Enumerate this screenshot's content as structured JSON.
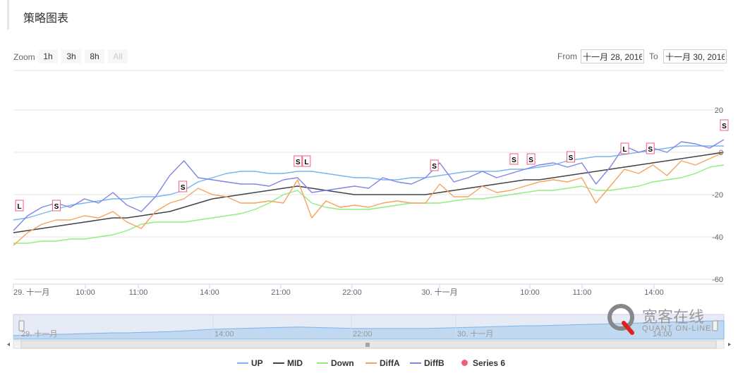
{
  "page_title": "策略图表",
  "zoom": {
    "label": "Zoom",
    "buttons": [
      {
        "label": "1h",
        "enabled": true
      },
      {
        "label": "3h",
        "enabled": true
      },
      {
        "label": "8h",
        "enabled": true
      },
      {
        "label": "All",
        "enabled": false
      }
    ]
  },
  "range": {
    "from_label": "From",
    "from_value": "十一月 28, 2016",
    "to_label": "To",
    "to_value": "十一月 30, 2016"
  },
  "watermark": {
    "text_cn": "宽客在线",
    "text_en": "QUANT ON-LiNE"
  },
  "chart_data": {
    "type": "line",
    "title": "",
    "xlabel": "",
    "ylabel": "",
    "ylim": [
      -60,
      20
    ],
    "y_ticks": [
      "20",
      "0",
      "-20",
      "-40",
      "-60"
    ],
    "x_ticks": [
      "29. 十一月",
      "10:00",
      "11:00",
      "14:00",
      "21:00",
      "22:00",
      "30. 十一月",
      "10:00",
      "11:00",
      "14:00"
    ],
    "navigator_ticks": [
      "29. 十一月",
      "14:00",
      "22:00",
      "30. 十一月",
      "14:00"
    ],
    "grid": true,
    "legend_position": "bottom",
    "series": [
      {
        "name": "UP",
        "color": "#7cb5ec",
        "values": [
          -32,
          -31,
          -29,
          -27,
          -25,
          -24,
          -23,
          -22,
          -22,
          -21,
          -21,
          -20,
          -18,
          -14,
          -12,
          -10,
          -9,
          -9,
          -10,
          -10,
          -9,
          -9,
          -10,
          -11,
          -12,
          -12,
          -13,
          -13,
          -12,
          -12,
          -11,
          -10,
          -9,
          -9,
          -9,
          -8,
          -8,
          -7,
          -6,
          -4,
          -3,
          -2,
          -2,
          -1,
          0,
          1,
          2,
          3,
          3,
          3,
          3
        ]
      },
      {
        "name": "MID",
        "color": "#434348",
        "values": [
          -38,
          -37,
          -36,
          -35,
          -34,
          -33,
          -32,
          -31,
          -31,
          -30,
          -29,
          -28,
          -26,
          -24,
          -22,
          -21,
          -20,
          -19,
          -18,
          -17,
          -16,
          -17,
          -18,
          -19,
          -20,
          -20,
          -20,
          -20,
          -20,
          -20,
          -19,
          -18,
          -17,
          -16,
          -15,
          -14,
          -13,
          -13,
          -12,
          -11,
          -10,
          -9,
          -8,
          -7,
          -6,
          -5,
          -4,
          -3,
          -2,
          -1,
          0
        ]
      },
      {
        "name": "Down",
        "color": "#90ed7d",
        "values": [
          -43,
          -43,
          -42,
          -42,
          -41,
          -41,
          -40,
          -39,
          -37,
          -34,
          -33,
          -33,
          -33,
          -32,
          -31,
          -30,
          -29,
          -27,
          -24,
          -20,
          -18,
          -24,
          -26,
          -27,
          -27,
          -27,
          -26,
          -25,
          -24,
          -24,
          -24,
          -23,
          -22,
          -22,
          -21,
          -20,
          -19,
          -18,
          -18,
          -17,
          -16,
          -18,
          -18,
          -17,
          -16,
          -14,
          -13,
          -12,
          -10,
          -7,
          -6
        ]
      },
      {
        "name": "DiffA",
        "color": "#f7a35c",
        "values": [
          -44,
          -38,
          -34,
          -32,
          -32,
          -30,
          -31,
          -28,
          -33,
          -36,
          -28,
          -24,
          -22,
          -17,
          -20,
          -21,
          -24,
          -24,
          -23,
          -24,
          -13,
          -31,
          -23,
          -26,
          -25,
          -26,
          -24,
          -23,
          -24,
          -24,
          -15,
          -21,
          -21,
          -16,
          -19,
          -18,
          -16,
          -14,
          -13,
          -14,
          -12,
          -24,
          -16,
          -8,
          -10,
          -6,
          -11,
          -4,
          -6,
          -3,
          0
        ]
      },
      {
        "name": "DiffB",
        "color": "#8085e9",
        "values": [
          -37,
          -30,
          -26,
          -24,
          -26,
          -22,
          -24,
          -19,
          -25,
          -28,
          -21,
          -11,
          -4,
          -12,
          -13,
          -14,
          -15,
          -15,
          -16,
          -13,
          -12,
          -19,
          -18,
          -17,
          -16,
          -17,
          -12,
          -14,
          -15,
          -12,
          -5,
          -14,
          -12,
          -9,
          -12,
          -10,
          -8,
          -6,
          -5,
          -7,
          -5,
          -15,
          -7,
          3,
          0,
          2,
          0,
          5,
          4,
          2,
          6
        ]
      },
      {
        "name": "Series 6",
        "color": "#f15c80",
        "values": []
      }
    ],
    "markers": [
      {
        "label": "L",
        "x_index": 0.4,
        "y": -26
      },
      {
        "label": "S",
        "x_index": 3.0,
        "y": -26
      },
      {
        "label": "S",
        "x_index": 11.9,
        "y": -17
      },
      {
        "label": "S",
        "x_index": 20.0,
        "y": -5
      },
      {
        "label": "L",
        "x_index": 20.6,
        "y": -5
      },
      {
        "label": "S",
        "x_index": 29.6,
        "y": -7
      },
      {
        "label": "S",
        "x_index": 35.2,
        "y": -4
      },
      {
        "label": "S",
        "x_index": 36.4,
        "y": -4
      },
      {
        "label": "S",
        "x_index": 39.2,
        "y": -3
      },
      {
        "label": "L",
        "x_index": 43.0,
        "y": 1
      },
      {
        "label": "S",
        "x_index": 44.8,
        "y": 1
      },
      {
        "label": "S",
        "x_index": 50.0,
        "y": 12
      }
    ]
  }
}
